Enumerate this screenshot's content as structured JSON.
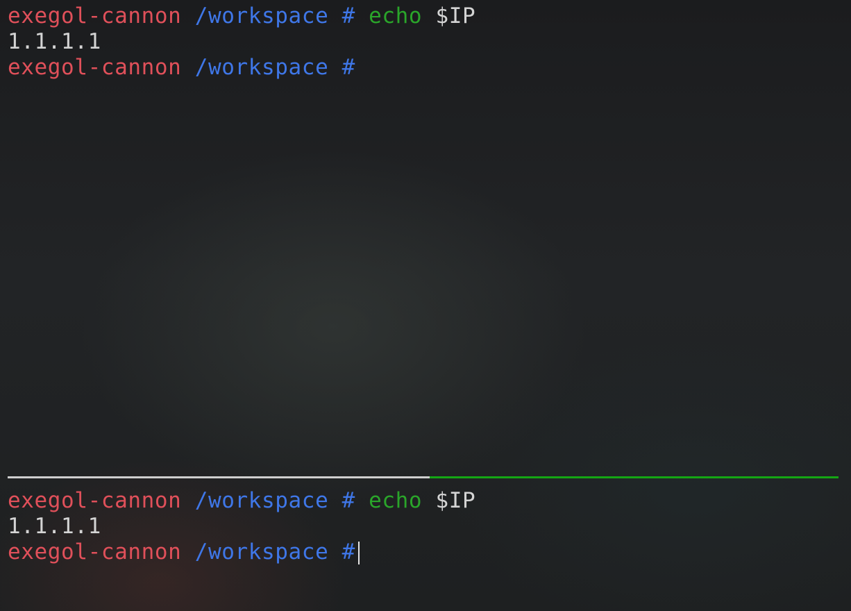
{
  "top_pane": {
    "line1": {
      "host": "exegol-cannon",
      "path": "/workspace",
      "hash": "#",
      "cmd": "echo",
      "arg": "$IP"
    },
    "line2": {
      "output": "1.1.1.1"
    },
    "line3": {
      "host": "exegol-cannon",
      "path": "/workspace",
      "hash": "#"
    }
  },
  "bottom_pane": {
    "line1": {
      "host": "exegol-cannon",
      "path": "/workspace",
      "hash": "#",
      "cmd": "echo",
      "arg": "$IP"
    },
    "line2": {
      "output": "1.1.1.1"
    },
    "line3": {
      "host": "exegol-cannon",
      "path": "/workspace",
      "hash": "#"
    }
  },
  "colors": {
    "host": "#e0505a",
    "path": "#3f77e8",
    "command": "#2aa52a",
    "text": "#d4d4d4",
    "divider_inactive": "#cfcfcf",
    "divider_active": "#14a614"
  }
}
